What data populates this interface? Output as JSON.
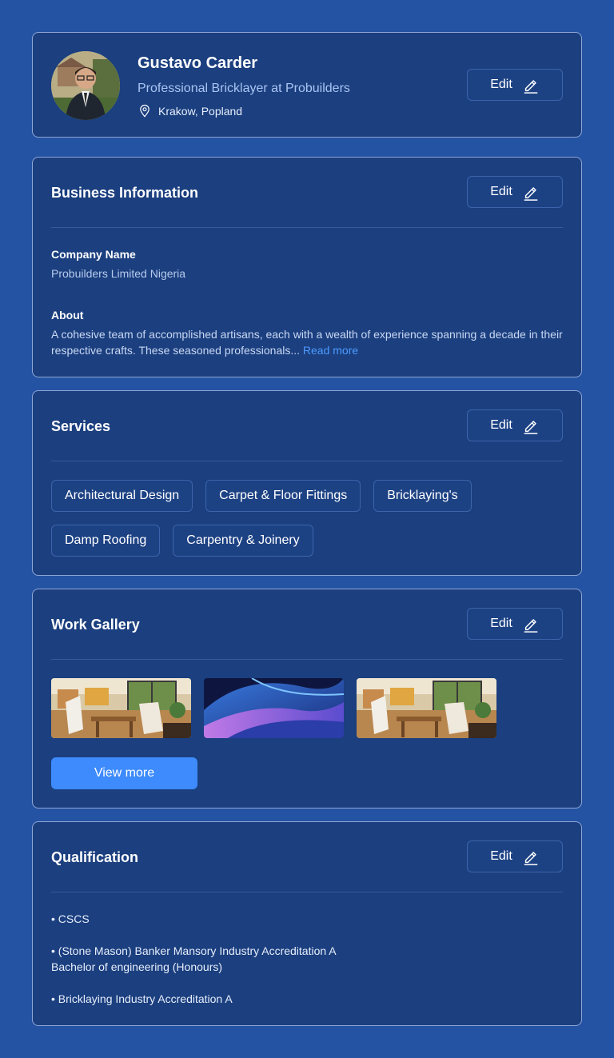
{
  "profile": {
    "name": "Gustavo Carder",
    "role": "Professional Bricklayer at Probuilders",
    "location": "Krakow, Popland",
    "edit_label": "Edit"
  },
  "business": {
    "title": "Business Information",
    "edit_label": "Edit",
    "company_label": "Company Name",
    "company_value": "Probuilders Limited Nigeria",
    "about_label": "About",
    "about_text": "A cohesive team of accomplished artisans, each with a wealth of experience spanning a decade in their respective crafts. These seasoned professionals...",
    "read_more": "Read more"
  },
  "services": {
    "title": "Services",
    "edit_label": "Edit",
    "items": [
      "Architectural Design",
      "Carpet & Floor Fittings",
      "Bricklaying's",
      "Damp Roofing",
      "Carpentry & Joinery"
    ]
  },
  "gallery": {
    "title": "Work Gallery",
    "edit_label": "Edit",
    "view_more": "View more"
  },
  "qualification": {
    "title": "Qualification",
    "edit_label": "Edit",
    "items": [
      "• CSCS",
      "• (Stone Mason) Banker Mansory Industry Accreditation A",
      "Bachelor of engineering (Honours)",
      "• Bricklaying Industry Accreditation A"
    ]
  },
  "icons": {
    "edit": "pencil-icon",
    "location": "location-pin-icon"
  },
  "colors": {
    "background": "#2553a3",
    "card": "#1b3f7f",
    "accent": "#3d8bfd",
    "link": "#4d9bff"
  }
}
